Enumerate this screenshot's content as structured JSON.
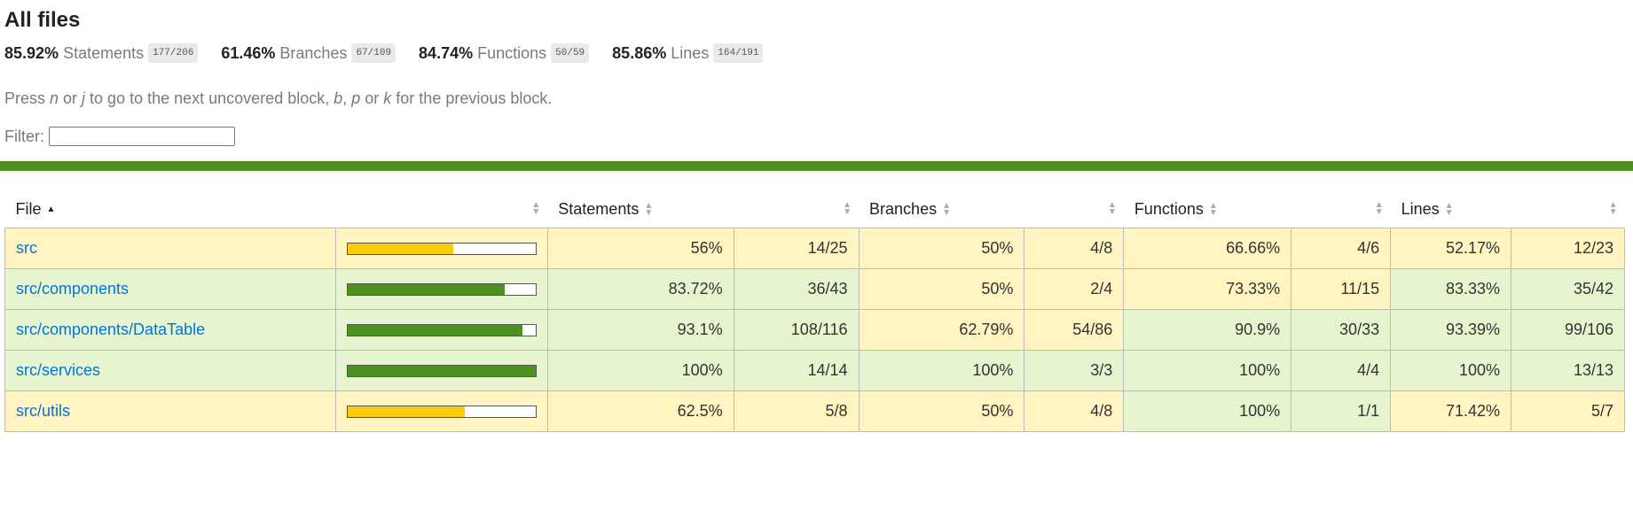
{
  "title": "All files",
  "summary": [
    {
      "pct": "85.92%",
      "label": "Statements",
      "fraction": "177/206"
    },
    {
      "pct": "61.46%",
      "label": "Branches",
      "fraction": "67/109"
    },
    {
      "pct": "84.74%",
      "label": "Functions",
      "fraction": "50/59"
    },
    {
      "pct": "85.86%",
      "label": "Lines",
      "fraction": "164/191"
    }
  ],
  "hint": {
    "p1": "Press ",
    "k1": "n",
    "p2": " or ",
    "k2": "j",
    "p3": " to go to the next uncovered block, ",
    "k3": "b",
    "p4": ", ",
    "k4": "p",
    "p5": " or ",
    "k5": "k",
    "p6": " for the previous block."
  },
  "filter": {
    "label": "Filter:",
    "value": ""
  },
  "table": {
    "headers": {
      "file": "File",
      "statements": "Statements",
      "branches": "Branches",
      "functions": "Functions",
      "lines": "Lines"
    },
    "rows": [
      {
        "file": "src",
        "level": "medium",
        "coverage": 0.56,
        "statements_pct": "56%",
        "statements_frac": "14/25",
        "statements_level": "medium",
        "branches_pct": "50%",
        "branches_frac": "4/8",
        "branches_level": "medium",
        "functions_pct": "66.66%",
        "functions_frac": "4/6",
        "functions_level": "medium",
        "lines_pct": "52.17%",
        "lines_frac": "12/23",
        "lines_level": "medium"
      },
      {
        "file": "src/components",
        "level": "high",
        "coverage": 0.8372,
        "statements_pct": "83.72%",
        "statements_frac": "36/43",
        "statements_level": "high",
        "branches_pct": "50%",
        "branches_frac": "2/4",
        "branches_level": "medium",
        "functions_pct": "73.33%",
        "functions_frac": "11/15",
        "functions_level": "medium",
        "lines_pct": "83.33%",
        "lines_frac": "35/42",
        "lines_level": "high"
      },
      {
        "file": "src/components/DataTable",
        "level": "high",
        "coverage": 0.931,
        "statements_pct": "93.1%",
        "statements_frac": "108/116",
        "statements_level": "high",
        "branches_pct": "62.79%",
        "branches_frac": "54/86",
        "branches_level": "medium",
        "functions_pct": "90.9%",
        "functions_frac": "30/33",
        "functions_level": "high",
        "lines_pct": "93.39%",
        "lines_frac": "99/106",
        "lines_level": "high"
      },
      {
        "file": "src/services",
        "level": "high",
        "coverage": 1.0,
        "statements_pct": "100%",
        "statements_frac": "14/14",
        "statements_level": "high",
        "branches_pct": "100%",
        "branches_frac": "3/3",
        "branches_level": "high",
        "functions_pct": "100%",
        "functions_frac": "4/4",
        "functions_level": "high",
        "lines_pct": "100%",
        "lines_frac": "13/13",
        "lines_level": "high"
      },
      {
        "file": "src/utils",
        "level": "medium",
        "coverage": 0.625,
        "statements_pct": "62.5%",
        "statements_frac": "5/8",
        "statements_level": "medium",
        "branches_pct": "50%",
        "branches_frac": "4/8",
        "branches_level": "medium",
        "functions_pct": "100%",
        "functions_frac": "1/1",
        "functions_level": "high",
        "lines_pct": "71.42%",
        "lines_frac": "5/7",
        "lines_level": "medium"
      }
    ]
  },
  "colors": {
    "high_bg": "#e6f5d0",
    "medium_bg": "#fff4c2",
    "high_bar": "#4d9221",
    "medium_bar": "#f9cd0b",
    "status_bar": "#4d9221",
    "link": "#0074d9"
  },
  "icons": {
    "sort": "sort-icon",
    "sort_asc": "sort-ascending-icon"
  }
}
